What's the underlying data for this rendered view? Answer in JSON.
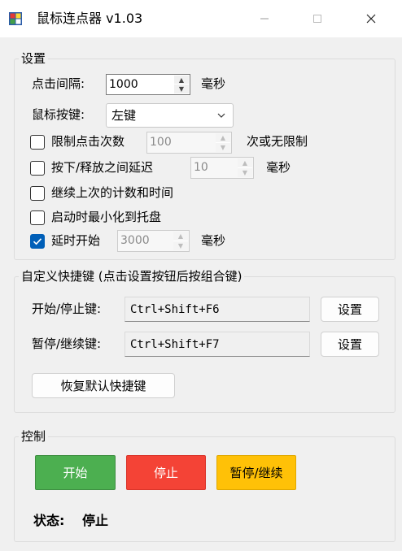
{
  "window": {
    "title": "鼠标连点器 v1.03"
  },
  "settings": {
    "group_title": "设置",
    "interval": {
      "label": "点击间隔:",
      "value": "1000",
      "unit": "毫秒"
    },
    "mouse_button": {
      "label": "鼠标按键:",
      "value": "左键"
    },
    "limit_clicks": {
      "label": "限制点击次数",
      "checked": false,
      "value": "100",
      "suffix": "次或无限制"
    },
    "press_delay": {
      "label": "按下/释放之间延迟",
      "checked": false,
      "value": "10",
      "unit": "毫秒"
    },
    "continue_last": {
      "label": "继续上次的计数和时间",
      "checked": false
    },
    "minimize_tray": {
      "label": "启动时最小化到托盘",
      "checked": false
    },
    "delay_start": {
      "label": "延时开始",
      "checked": true,
      "value": "3000",
      "unit": "毫秒"
    }
  },
  "hotkeys": {
    "group_title": "自定义快捷键 (点击设置按钮后按组合键)",
    "start_stop": {
      "label": "开始/停止键:",
      "value": "Ctrl+Shift+F6",
      "button": "设置"
    },
    "pause_resume": {
      "label": "暂停/继续键:",
      "value": "Ctrl+Shift+F7",
      "button": "设置"
    },
    "restore_label": "恢复默认快捷键"
  },
  "control": {
    "group_title": "控制",
    "start_label": "开始",
    "stop_label": "停止",
    "pause_label": "暂停/继续",
    "status_label": "状态:",
    "status_value": "停止",
    "colors": {
      "start": "#4caf50",
      "stop": "#f44336",
      "pause": "#ffc107"
    }
  }
}
